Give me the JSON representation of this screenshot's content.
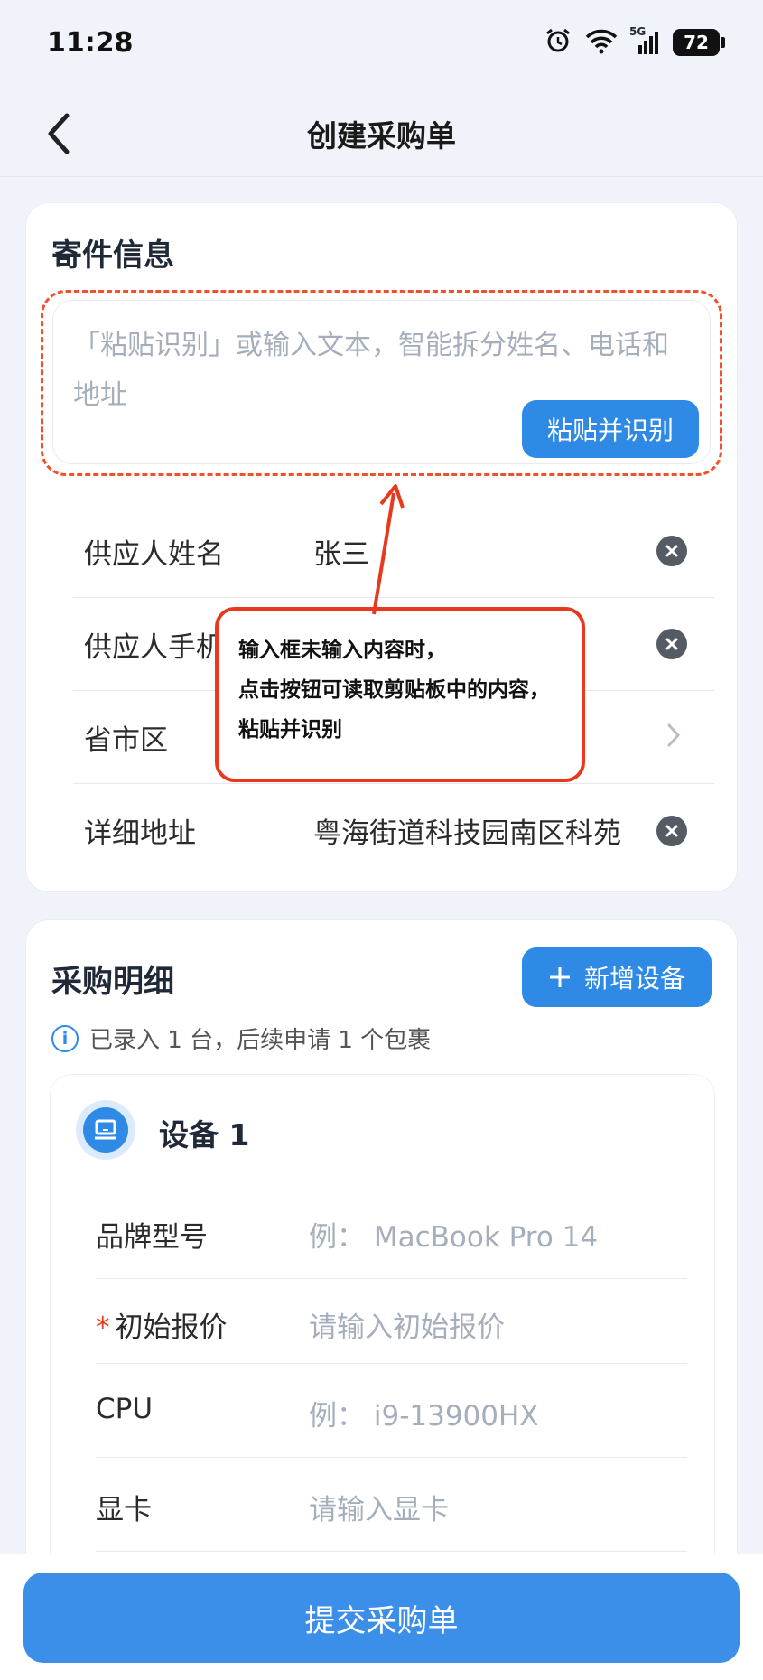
{
  "status_bar": {
    "time": "11:28",
    "network": "5G",
    "battery": "72"
  },
  "header": {
    "title": "创建采购单"
  },
  "sender_section": {
    "title": "寄件信息",
    "paste_placeholder": "「粘贴识别」或输入文本，智能拆分姓名、电话和地址",
    "paste_button": "粘贴并识别",
    "fields": [
      {
        "label": "供应人姓名",
        "value": "张三"
      },
      {
        "label": "供应人手机",
        "value": ""
      },
      {
        "label": "省市区",
        "value": ""
      },
      {
        "label": "详细地址",
        "value": "粤海街道科技园南区科苑"
      }
    ]
  },
  "annotation": {
    "lines": [
      "输入框未输入内容时，",
      "点击按钮可读取剪贴板中的内容，",
      "粘贴并识别"
    ],
    "color": "#e8391f"
  },
  "purchase_section": {
    "title": "采购明细",
    "add_button": "新增设备",
    "info_text": "已录入 1 台，后续申请 1 个包裹",
    "device": {
      "title": "设备 1",
      "fields": [
        {
          "label": "品牌型号",
          "placeholder": "例：  MacBook Pro 14",
          "required": false
        },
        {
          "label": "初始报价",
          "placeholder": "请输入初始报价",
          "required": true
        },
        {
          "label": "CPU",
          "placeholder": "例：  i9-13900HX",
          "required": false
        },
        {
          "label": "显卡",
          "placeholder": "请输入显卡",
          "required": false
        }
      ]
    }
  },
  "footer": {
    "submit_button": "提交采购单"
  },
  "colors": {
    "primary": "#2f8ae6",
    "annotation_red": "#e8391f"
  }
}
